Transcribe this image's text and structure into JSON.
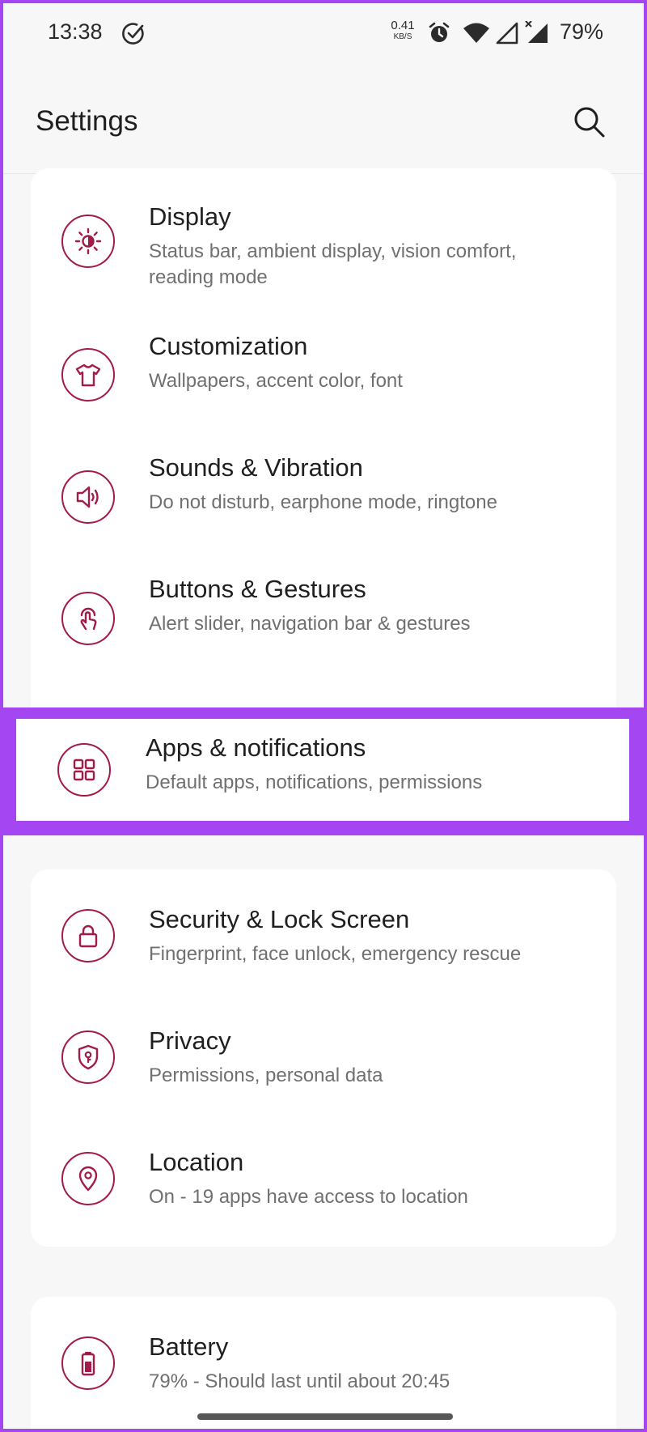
{
  "status_bar": {
    "time": "13:38",
    "net_speed_value": "0.41",
    "net_speed_unit": "KB/S",
    "battery": "79%",
    "icons": [
      "check-circle-icon",
      "alarm-icon",
      "wifi-icon",
      "signal-icon",
      "signal-x-icon"
    ]
  },
  "header": {
    "title": "Settings",
    "search_icon": "search-icon"
  },
  "accent_color": "#a31b47",
  "highlight_color": "#a447f2",
  "items": [
    {
      "title": "Display",
      "subtitle": "Status bar, ambient display, vision comfort, reading mode",
      "icon": "brightness-icon"
    },
    {
      "title": "Customization",
      "subtitle": "Wallpapers, accent color, font",
      "icon": "tshirt-icon"
    },
    {
      "title": "Sounds & Vibration",
      "subtitle": "Do not disturb, earphone mode, ringtone",
      "icon": "speaker-icon"
    },
    {
      "title": "Buttons & Gestures",
      "subtitle": "Alert slider, navigation bar & gestures",
      "icon": "gesture-icon"
    },
    {
      "title": "Apps & notifications",
      "subtitle": "Default apps, notifications, permissions",
      "icon": "apps-grid-icon",
      "highlighted": true
    },
    {
      "title": "Security & Lock Screen",
      "subtitle": "Fingerprint, face unlock, emergency rescue",
      "icon": "lock-icon"
    },
    {
      "title": "Privacy",
      "subtitle": "Permissions, personal data",
      "icon": "privacy-shield-icon"
    },
    {
      "title": "Location",
      "subtitle": "On - 19 apps have access to location",
      "icon": "location-pin-icon"
    },
    {
      "title": "Battery",
      "subtitle": "79% - Should last until about 20:45",
      "icon": "battery-icon"
    }
  ]
}
